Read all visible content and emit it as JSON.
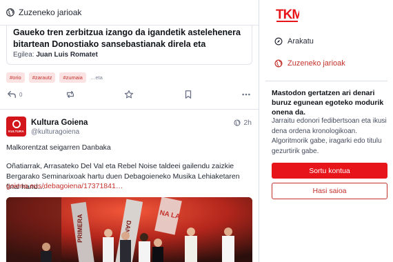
{
  "header": {
    "title": "Zuzeneko jarioak",
    "icon": "globe-icon"
  },
  "boosted_card": {
    "title": "Gaueko tren zerbitzua izango da igandetik astelehenera bitartean Donostiako sansebastianak direla eta",
    "author_label": "Egilea:",
    "author_name": "Juan Luis Romatet"
  },
  "tags": [
    "#orio",
    "#zarautz",
    "#zumaia"
  ],
  "tags_more": "…eta",
  "actions": {
    "reply_count": "0"
  },
  "post": {
    "display_name": "Kultura Goiena",
    "handle": "@kulturagoiena",
    "time": "2h",
    "avatar_text": "KULTURA",
    "lead": "Malkorentzat seigarren Danbaka",
    "body": "Oñatiarrak, Arrasateko Del Val eta Rebel Noise taldeei gailendu zaizkie Bergarako Seminarixoak hartu duen Debagoieneko Musika Lehiaketaren final hand…",
    "link": "goiena.eus/debagoiena/17371841…",
    "media_texts": [
      "DANBAKA",
      "NA LA",
      "PRIMERA"
    ]
  },
  "sidebar": {
    "logo": "TKM",
    "nav": {
      "explore": "Arakatu",
      "live": "Zuzeneko jarioak"
    },
    "heading": "Mastodon gertatzen ari denari buruz egunean egoteko modurik onena da.",
    "text": "Jarraitu edonori fedibertsoan eta ikusi dena ordena kronologikoan. Algoritmorik gabe, iragarki edo titulu gezurtirik gabe.",
    "signup": "Sortu kontua",
    "login": "Hasi saioa"
  },
  "colors": {
    "accent": "#e7141a",
    "link": "#c4302b",
    "tag_bg": "#fbe3e3"
  }
}
